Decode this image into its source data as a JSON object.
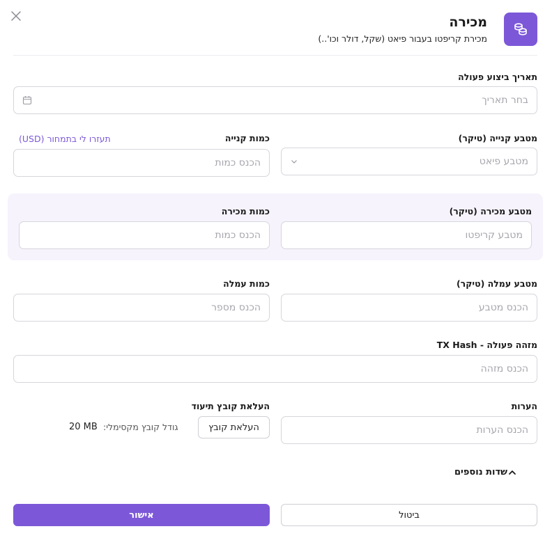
{
  "header": {
    "title": "מכירה",
    "subtitle": "מכירת קריפטו בעבור פיאט (שקל, דולר וכו'..)",
    "icon": "coins-icon"
  },
  "close": {
    "icon": "close-icon"
  },
  "date": {
    "label": "תאריך ביצוע פעולה",
    "placeholder": "בחר תאריך",
    "icon": "calendar-icon"
  },
  "buy": {
    "currency_label": "מטבע קנייה (טיקר)",
    "currency_placeholder": "מטבע פיאט",
    "amount_label": "כמות קנייה",
    "amount_placeholder": "הכנס כמות",
    "helper_link": "תעזרו לי בתמחור (USD)"
  },
  "sell": {
    "currency_label": "מטבע מכירה (טיקר)",
    "currency_placeholder": "מטבע קריפטו",
    "amount_label": "כמות מכירה",
    "amount_placeholder": "הכנס כמות"
  },
  "fee": {
    "currency_label": "מטבע עמלה (טיקר)",
    "currency_placeholder": "הכנס מטבע",
    "amount_label": "כמות עמלה",
    "amount_placeholder": "הכנס מספר"
  },
  "tx": {
    "label": "מזהה פעולה - TX Hash",
    "placeholder": "הכנס מזהה"
  },
  "notes": {
    "label": "הערות",
    "placeholder": "הכנס הערות"
  },
  "upload": {
    "label": "העלאת קובץ תיעוד",
    "button": "העלאת קובץ",
    "hint": "גודל קובץ מקסימלי:",
    "max_size": "20 MB"
  },
  "extra": {
    "label": "שדות נוספים",
    "icon": "chevron-up-icon"
  },
  "actions": {
    "cancel": "ביטול",
    "confirm": "אישור"
  },
  "colors": {
    "accent": "#7c58d8",
    "sell_bg": "#f6f3fd",
    "border": "#d6d6dc",
    "placeholder": "#a6a6ae"
  }
}
